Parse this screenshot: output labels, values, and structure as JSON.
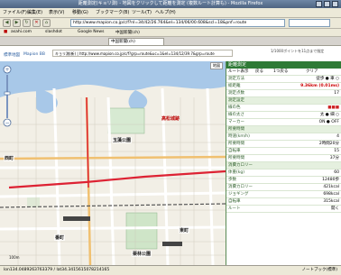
{
  "window": {
    "title": "距離測定(キョリ測) - 地図をクリックして距離を測定 (複数ルート計算も) - Mozilla Firefox"
  },
  "menu": [
    "ファイル(F)",
    "編集(E)",
    "表示(V)",
    "移動(G)",
    "ブックマーク(B)",
    "ツール(T)",
    "ヘルプ(H)"
  ],
  "nav": {
    "url": "http://www.mapion.co.jp/c/f?nl=34/42/26.764&el=134/06/00.608&scl=18&pnf=route"
  },
  "bookmarks": [
    "asahi.com",
    "slashdot",
    "Google News",
    "中国新聞(ch)"
  ],
  "tab": {
    "label": "中国新聞(ch)"
  },
  "site": {
    "links": [
      "標準地図",
      "Mapion BB"
    ],
    "url2": "キョリ測(新) | http://www.mapion.co.jp/c/f?grp=route&uc=1&el=134/12/39.7&grp=route",
    "note": "1/1000ポイントを11点まで指定"
  },
  "map": {
    "labels": {
      "castle": "高松城跡",
      "park": "栗林公園",
      "ekimae": "西町",
      "sanuki": "玉藻公園",
      "east": "東町",
      "kawa": "番町"
    },
    "scale": "100m",
    "legend": "地図"
  },
  "panel": {
    "title": "距離測定",
    "tabs": [
      "ルート表示",
      "戻る",
      "1つ戻る",
      "クリア"
    ],
    "route_label": "測定方法",
    "route_value": "徒歩 ● 車 ○",
    "total_label": "総距離",
    "total_value": "9.36km (0.01ms)",
    "points_label": "測定点数",
    "points_value": "17",
    "sec_measure": "測定設定",
    "line_color_label": "線の色",
    "line_color_value": "■■■",
    "line_width_label": "線の太さ",
    "line_width_value": "太 ● 細 ○",
    "marker_label": "マーカー",
    "marker_value": "ON ● OFF",
    "sec_time": "所要時間",
    "walk_label": "時速(km/h)",
    "walk_value": "4",
    "walk_time_label": "所要時間",
    "walk_time_value": "2時間20分",
    "bike_label": "自転車",
    "bike_value": "15",
    "bike_time_label": "所要時間",
    "bike_time_value": "37分",
    "sec_cal": "消費カロリー",
    "weight_label": "体重(kg)",
    "weight_value": "60",
    "step_label": "歩数",
    "step_value": "12480歩",
    "cal_label": "消費カロリー",
    "cal_value": "421kcal",
    "jog_label": "ジョギング",
    "jog_value": "698kcal",
    "run_label": "自転車",
    "run_value": "315kcal",
    "bottom_label": "ルート",
    "bottom_value": "開く"
  },
  "status": {
    "text": "lon134.0489263763379 / lat34.3415615078214165",
    "right": "ノートブック(標準)"
  }
}
